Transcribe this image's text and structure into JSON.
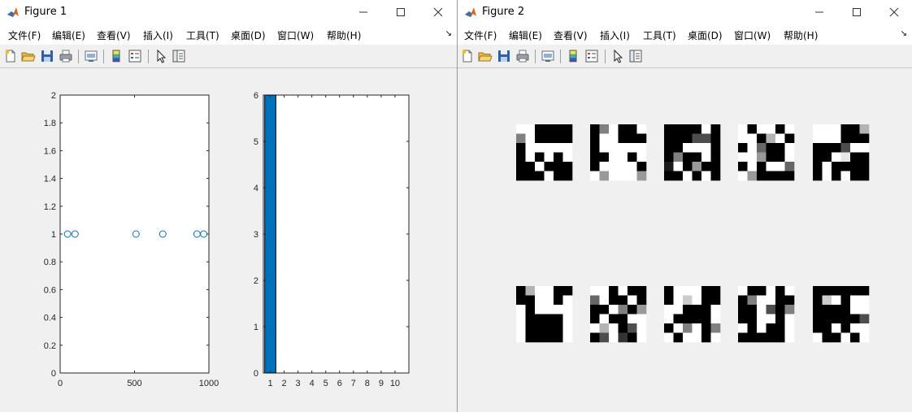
{
  "figure1": {
    "title": "Figure 1",
    "menus": [
      "文件(F)",
      "编辑(E)",
      "查看(V)",
      "插入(I)",
      "工具(T)",
      "桌面(D)",
      "窗口(W)",
      "帮助(H)"
    ],
    "toolbar_icons": [
      "new-figure-icon",
      "open-file-icon",
      "save-icon",
      "print-icon",
      "print-preview-icon",
      "insert-colorbar-icon",
      "insert-legend-icon",
      "edit-plot-icon",
      "property-inspector-icon"
    ]
  },
  "figure2": {
    "title": "Figure 2",
    "menus": [
      "文件(F)",
      "编辑(E)",
      "查看(V)",
      "插入(I)",
      "工具(T)",
      "桌面(D)",
      "窗口(W)",
      "帮助(H)"
    ],
    "toolbar_icons": [
      "new-figure-icon",
      "open-file-icon",
      "save-icon",
      "print-icon",
      "print-preview-icon",
      "insert-colorbar-icon",
      "insert-legend-icon",
      "edit-plot-icon",
      "property-inspector-icon"
    ],
    "images": [
      [
        [
          1,
          1,
          0,
          0,
          0,
          0
        ],
        [
          0.5,
          1,
          0,
          0,
          0,
          0
        ],
        [
          0,
          1,
          1,
          1,
          1,
          1
        ],
        [
          0,
          1,
          0,
          1,
          0,
          1
        ],
        [
          0,
          0,
          1,
          0,
          0,
          0
        ],
        [
          0,
          0,
          0,
          1,
          0,
          0
        ]
      ],
      [
        [
          0,
          0.5,
          1,
          0,
          0,
          1
        ],
        [
          0,
          1,
          1,
          0,
          0,
          0
        ],
        [
          0,
          1,
          1,
          1,
          1,
          1
        ],
        [
          0,
          0,
          1,
          1,
          0,
          1
        ],
        [
          0,
          1,
          1,
          1,
          1,
          0
        ],
        [
          1,
          0.6,
          1,
          1,
          1,
          0.6
        ]
      ],
      [
        [
          0,
          0,
          0,
          0,
          1,
          0
        ],
        [
          0,
          0,
          0,
          0.3,
          0.3,
          0
        ],
        [
          0,
          0,
          1,
          1,
          1,
          0
        ],
        [
          0,
          0.5,
          0,
          0,
          1,
          0
        ],
        [
          0.1,
          1,
          0,
          0.6,
          0,
          0
        ],
        [
          0,
          0,
          1,
          0,
          1,
          0
        ]
      ],
      [
        [
          1,
          0,
          1,
          1,
          0,
          1
        ],
        [
          1,
          1,
          0,
          0.7,
          1,
          0
        ],
        [
          0,
          1,
          0.4,
          0,
          0,
          1
        ],
        [
          1,
          1,
          0.6,
          0,
          0,
          1
        ],
        [
          0,
          1,
          0,
          1,
          1,
          0.4
        ],
        [
          1,
          0.6,
          0,
          0,
          0,
          0
        ]
      ],
      [
        [
          1,
          1,
          1,
          0,
          0,
          0.7
        ],
        [
          1,
          1,
          1,
          0,
          0,
          0
        ],
        [
          0,
          0,
          0,
          0.3,
          1,
          1
        ],
        [
          0,
          0,
          1,
          0.9,
          0,
          0
        ],
        [
          0,
          1,
          0,
          0,
          0,
          0
        ],
        [
          0,
          1,
          0,
          1,
          0,
          0
        ]
      ],
      [
        [
          0,
          0.7,
          1,
          1,
          0,
          0
        ],
        [
          0,
          0,
          1,
          1,
          0,
          1
        ],
        [
          1,
          0,
          1,
          1,
          1,
          1
        ],
        [
          1,
          0,
          0,
          0,
          0,
          1
        ],
        [
          1,
          0,
          0,
          0,
          0,
          1
        ],
        [
          1,
          0,
          0,
          0,
          0,
          1
        ]
      ],
      [
        [
          1,
          1,
          0,
          1,
          0,
          0
        ],
        [
          0.4,
          1,
          0,
          0,
          1,
          0
        ],
        [
          0,
          0,
          1,
          0.5,
          0,
          0.6
        ],
        [
          0,
          1,
          0,
          0,
          1,
          1
        ],
        [
          1,
          0.7,
          1,
          0,
          0.3,
          1
        ],
        [
          0,
          0.3,
          1,
          0.2,
          0,
          1
        ]
      ],
      [
        [
          0,
          1,
          1,
          1,
          0,
          0
        ],
        [
          0,
          1,
          0.8,
          1,
          0,
          0
        ],
        [
          1,
          1,
          0,
          0,
          0,
          1
        ],
        [
          1,
          0,
          0,
          0,
          0,
          1
        ],
        [
          0,
          1,
          0.5,
          1,
          0,
          0.5
        ],
        [
          1,
          0,
          1,
          1,
          0,
          1
        ]
      ],
      [
        [
          1,
          0,
          0,
          1,
          0,
          1
        ],
        [
          0,
          0.5,
          1,
          1,
          0,
          0
        ],
        [
          0,
          0,
          1,
          0.3,
          0,
          0.5
        ],
        [
          0,
          0,
          1,
          1,
          0,
          1
        ],
        [
          1,
          0,
          1,
          0,
          0,
          1
        ],
        [
          0,
          0,
          0,
          0,
          0,
          1
        ]
      ],
      [
        [
          0,
          0,
          0,
          0,
          0,
          0
        ],
        [
          0,
          0.8,
          1,
          0,
          1,
          1
        ],
        [
          0,
          0,
          0,
          0,
          1,
          1
        ],
        [
          0,
          0,
          0,
          0,
          0,
          0.3
        ],
        [
          0,
          0,
          1,
          0,
          1,
          1
        ],
        [
          1,
          0,
          0,
          1,
          0,
          1
        ]
      ]
    ]
  },
  "chart_data": [
    {
      "type": "scatter",
      "x": [
        50,
        100,
        510,
        690,
        920,
        965
      ],
      "y": [
        1,
        1,
        1,
        1,
        1,
        1
      ],
      "xlim": [
        0,
        1000
      ],
      "ylim": [
        0,
        2
      ],
      "xticks": [
        "0",
        "500",
        "1000"
      ],
      "yticks": [
        "0",
        "0.2",
        "0.4",
        "0.6",
        "0.8",
        "1",
        "1.2",
        "1.4",
        "1.6",
        "1.8",
        "2"
      ],
      "marker": "circle-open",
      "color": "#0072BD",
      "grid": false
    },
    {
      "type": "bar",
      "categories": [
        "1",
        "2",
        "3",
        "4",
        "5",
        "6",
        "7",
        "8",
        "9",
        "10"
      ],
      "values": [
        6,
        0,
        0,
        0,
        0,
        0,
        0,
        0,
        0,
        0
      ],
      "xlim": [
        0.5,
        11
      ],
      "ylim": [
        0,
        6
      ],
      "yticks": [
        "0",
        "1",
        "2",
        "3",
        "4",
        "5",
        "6"
      ],
      "color": "#0072BD",
      "grid": false
    }
  ]
}
